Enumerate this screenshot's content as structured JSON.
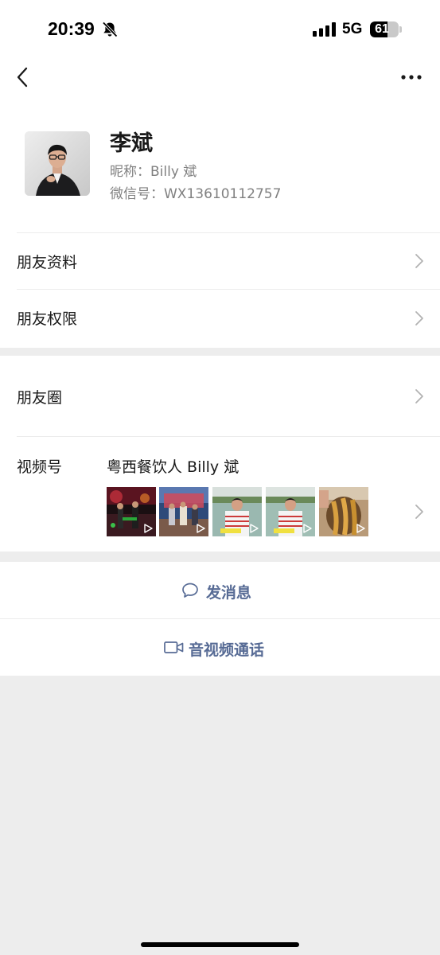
{
  "status_bar": {
    "time": "20:39",
    "network": "5G",
    "battery": "61",
    "battery_level": 0.61,
    "bell_icon": "bell-slash-icon",
    "signal_icon": "cellular-signal-icon"
  },
  "nav": {
    "back_icon": "chevron-left-icon",
    "more_icon": "ellipsis-icon"
  },
  "profile": {
    "name": "李斌",
    "nickname": "昵称：Billy 斌",
    "wechat_id": "微信号：WX13610112757"
  },
  "menu": {
    "friend_profile": "朋友资料",
    "friend_permissions": "朋友权限",
    "moments": "朋友圈"
  },
  "channels": {
    "label": "视频号",
    "name": "粤西餐饮人 Billy 斌",
    "thumbnail_icon": "play-icon"
  },
  "actions": {
    "message": "发消息",
    "message_icon": "chat-bubble-icon",
    "call": "音视频通话",
    "call_icon": "video-camera-icon"
  },
  "colors": {
    "link": "#576b95",
    "background": "#ededed",
    "secondary_text": "#808080"
  }
}
